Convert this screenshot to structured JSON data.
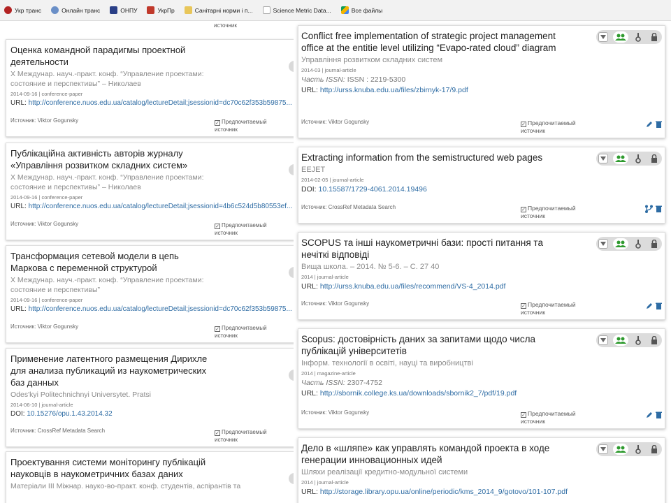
{
  "bookmarks": [
    {
      "label": "Укр транс",
      "icon": "ukrtrans-icon",
      "color": "#b22222"
    },
    {
      "label": "Онлайн транс",
      "icon": "online-translate-icon",
      "color": "#6a8fc7"
    },
    {
      "label": "ОНПУ",
      "icon": "onpu-shield-icon",
      "color": "#2a3f87"
    },
    {
      "label": "УкрПр",
      "icon": "ukrpr-icon",
      "color": "#c0392b"
    },
    {
      "label": "Санітарні норми і п...",
      "icon": "folder-icon",
      "color": "#e8c65a"
    },
    {
      "label": "Science Metric Data...",
      "icon": "page-icon",
      "color": "#cccccc"
    },
    {
      "label": "Все файлы",
      "icon": "google-drive-icon",
      "color": "#f4b400"
    }
  ],
  "common": {
    "source_prefix": "Источник:",
    "preferred_line1": "Предпочитаемый",
    "preferred_line2": "источник"
  },
  "left_cards": [
    {
      "title": "Оценка командной парадигмы проектной деятельности",
      "subtitle": "X Междунар. науч.-практ. конф. “Управление проектами: состояние и перспективы” – Николаев",
      "meta": "2014-09-16 | conference-paper",
      "url_prefix": "URL:",
      "url": "http://conference.nuos.edu.ua/catalog/lectureDetail;jsessionid=dc70c62f353b59875...",
      "source": "Viktor Gogunsky"
    },
    {
      "title": "Публікаційна активність авторів журналу «Управління розвитком складних систем»",
      "subtitle": "X Междунар. науч.-практ. конф. “Управление проектами: состояние и перспективы” – Николаев",
      "meta": "2014-09-16 | conference-paper",
      "url_prefix": "URL:",
      "url": "http://conference.nuos.edu.ua/catalog/lectureDetail;jsessionid=4b6c524d5b80553ef...",
      "source": "Viktor Gogunsky"
    },
    {
      "title": "Трансформация сетевой модели в цепь Маркова с переменной структурой",
      "subtitle": "X Междунар. науч.-практ. конф. “Управление проектами: состояние и перспективы”",
      "meta": "2014-09-16 | conference-paper",
      "url_prefix": "URL:",
      "url": "http://conference.nuos.edu.ua/catalog/lectureDetail;jsessionid=dc70c62f353b59875...",
      "source": "Viktor Gogunsky"
    },
    {
      "title": "Применение латентного размещения Дирихле для анализа публикаций из наукометрических баз данных",
      "subtitle": "Odes'kyi Politechnichnyi Universytet. Pratsi",
      "meta": "2014-06-10 | journal-article",
      "url_prefix": "DOI:",
      "url": "10.15276/opu.1.43.2014.32",
      "source": "CrossRef Metadata Search"
    },
    {
      "title": "Проектування системи моніторингу публікацій науковців в наукометричних базах даних",
      "subtitle": "Матеріали III Міжнар. науко-во-практ. конф. студентів, аспірантів та",
      "meta": "",
      "url_prefix": "",
      "url": "",
      "source": ""
    }
  ],
  "right_cards": [
    {
      "title": "Conflict free implementation of strategic project management office at the entitie level utilizing “Evapo-rated cloud” diagram",
      "subtitle": "Управління розвитком складних систем",
      "meta": "2014-03 | journal-article",
      "issn_label": "Часть ISSN:",
      "issn": "ISSN : 2219-5300",
      "url_prefix": "URL:",
      "url": "http://urss.knuba.edu.ua/files/zbirnyk-17/9.pdf",
      "source": "Viktor Gogunsky",
      "action": "edit-delete"
    },
    {
      "title": "Extracting information from the semistructured web pages",
      "subtitle": "EEJET",
      "meta": "2014-02-05 | journal-article",
      "issn_label": "",
      "issn": "",
      "url_prefix": "DOI:",
      "url": "10.15587/1729-4061.2014.19496",
      "source": "CrossRef Metadata Search",
      "action": "merge-delete"
    },
    {
      "title": "SCOPUS та інші наукометричні бази: прості питання та нечіткі відповіді",
      "subtitle": "Вища школа. – 2014. № 5-6. – С. 27 40",
      "meta": "2014 | journal-article",
      "issn_label": "",
      "issn": "",
      "url_prefix": "URL:",
      "url": "http://urss.knuba.edu.ua/files/recommend/VS-4_2014.pdf",
      "source": "Viktor Gogunsky",
      "action": "edit-delete"
    },
    {
      "title": "Scopus: достовірність даних за запитами щодо числа публікацій університетів",
      "subtitle": "Інформ. технології в освіті, науці та виробництві",
      "meta": "2014 | magazine-article",
      "issn_label": "Часть ISSN:",
      "issn": "2307-4752",
      "url_prefix": "URL:",
      "url": "http://sbornik.college.ks.ua/downloads/sbornik2_7/pdf/19.pdf",
      "source": "Viktor Gogunsky",
      "action": "edit-delete"
    },
    {
      "title": "Дело в «шляпе» как управлять командой проекта в ходе генерации инновационных идей",
      "subtitle": "Шляхи реалізації кредитно-модульної системи",
      "meta": "2014 | journal-article",
      "issn_label": "",
      "issn": "",
      "url_prefix": "URL:",
      "url": "http://storage.library.opu.ua/online/periodic/kms_2014_9/gotovo/101-107.pdf",
      "source": "",
      "action": ""
    }
  ],
  "colors": {
    "link": "#2e6ca4",
    "group_green": "#2e9a2e",
    "toolbar_bg": "#dcdcdc"
  }
}
